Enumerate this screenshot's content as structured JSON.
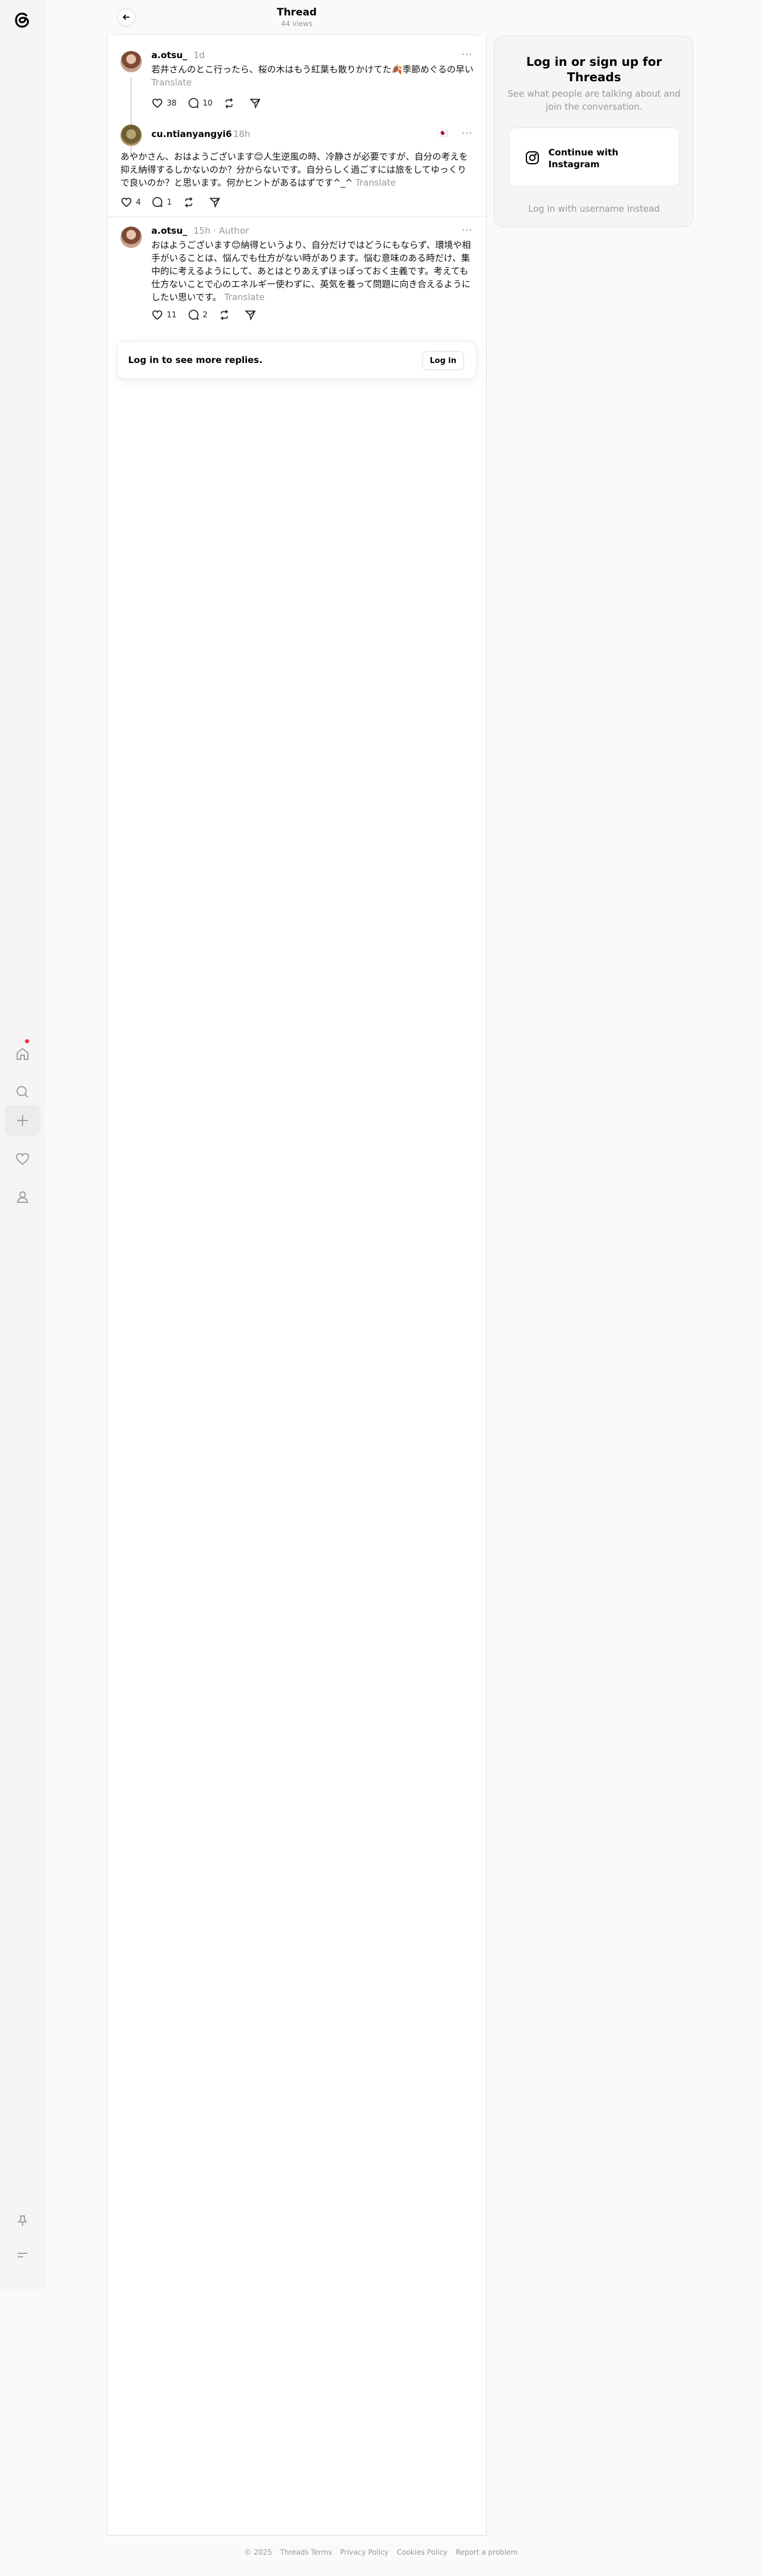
{
  "header": {
    "title": "Thread",
    "views": "44 views"
  },
  "posts": [
    {
      "username": "a.otsu_",
      "time": "1d",
      "author_tag": "",
      "text": "若井さんのとこ行ったら、桜の木はもう紅葉も散りかけてた🍂季節めぐるの早い",
      "translate": "Translate",
      "likes": "38",
      "replies": "10"
    },
    {
      "username": "cu.ntianyangyi6",
      "time": "18h",
      "flag": "🇯🇵",
      "text": "あやかさん、おはようございます😊人生逆風の時、冷静さが必要ですが、自分の考えを抑え納得するしかないのか？分からないです。自分らしく過ごすには旅をしてゆっくりで良いのか？と思います。何かヒントがあるはずです^_^",
      "translate": "Translate",
      "likes": "4",
      "replies": "1"
    },
    {
      "username": "a.otsu_",
      "time": "15h",
      "author_tag": "Author",
      "text": "おはようございます😊納得というより、自分だけではどうにもならず、環境や相手がいることは、悩んでも仕方がない時があります。悩む意味のある時だけ、集中的に考えるようにして、あとはとりあえずほっぽっておく主義です。考えても仕方ないことで心のエネルギー使わずに、英気を養って問題に向き合えるようにしたい思いです。",
      "translate": "Translate",
      "likes": "11",
      "replies": "2"
    }
  ],
  "login_bar": {
    "text": "Log in to see more replies.",
    "button": "Log in"
  },
  "sidebar_card": {
    "title": "Log in or sign up for Threads",
    "subtitle": "See what people are talking about and join the conversation.",
    "instagram_button": "Continue with Instagram",
    "alt_login": "Log in with username instead"
  },
  "footer": {
    "items": [
      "© 2025",
      "Threads Terms",
      "Privacy Policy",
      "Cookies Policy",
      "Report a problem"
    ]
  },
  "nav_icons": [
    "threads-logo-icon",
    "home-icon",
    "search-icon",
    "create-icon",
    "heart-icon",
    "profile-icon",
    "pin-icon",
    "menu-icon"
  ]
}
